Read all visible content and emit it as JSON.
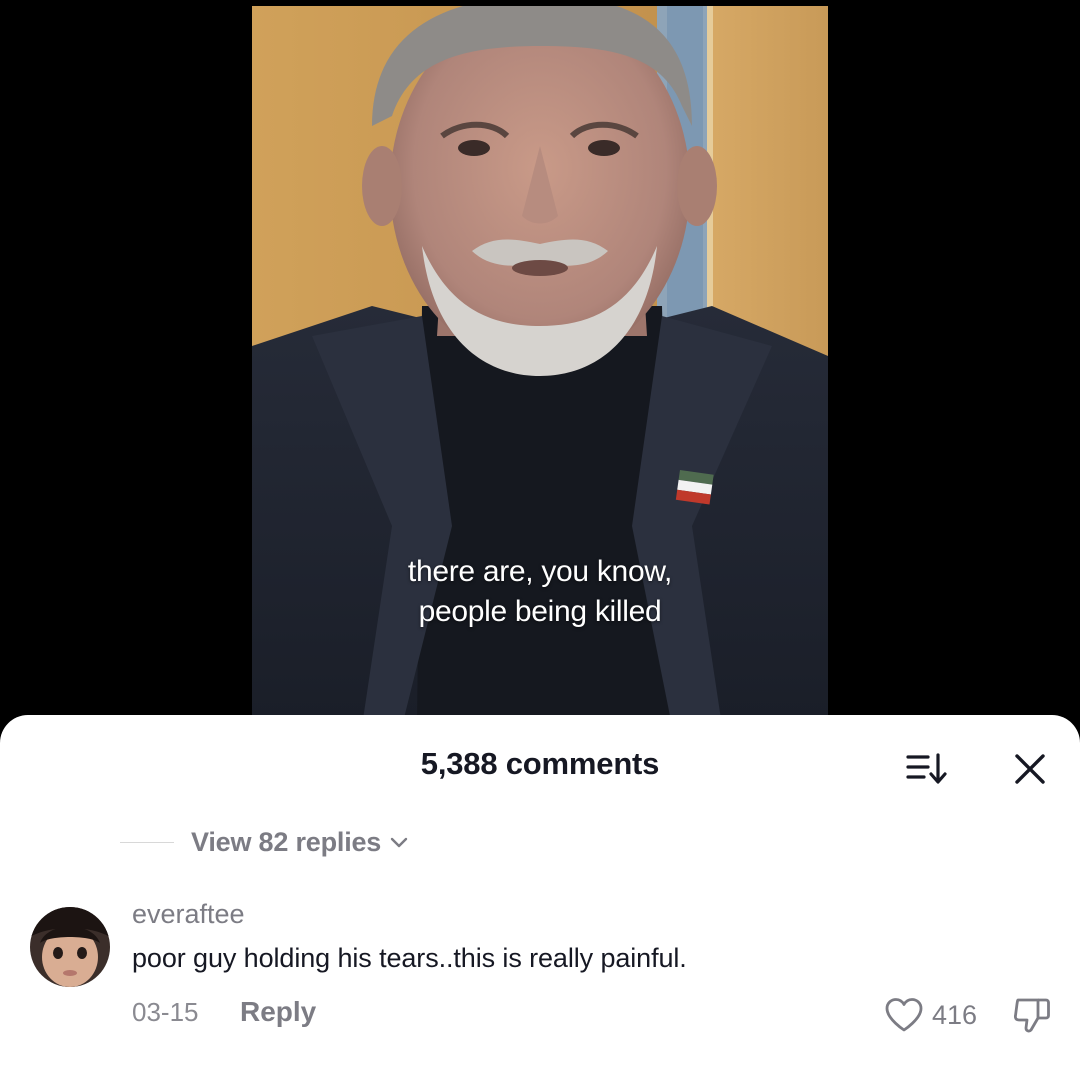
{
  "video": {
    "caption_lines": [
      "there are, you know,",
      "people being killed"
    ]
  },
  "comments_panel": {
    "title": "5,388 comments",
    "sort_icon": "sort-icon",
    "close_icon": "close-icon",
    "view_replies_label": "View 82 replies",
    "comment": {
      "username": "everaftee",
      "text": "poor guy holding his tears..this is really painful.",
      "date": "03-15",
      "reply_label": "Reply",
      "like_count": "416",
      "like_icon": "heart-icon",
      "dislike_icon": "thumbs-down-icon"
    }
  },
  "colors": {
    "sheet_background": "#ffffff",
    "primary_text": "#161823",
    "secondary_text": "#7c7c84",
    "video_background": "#000000"
  }
}
